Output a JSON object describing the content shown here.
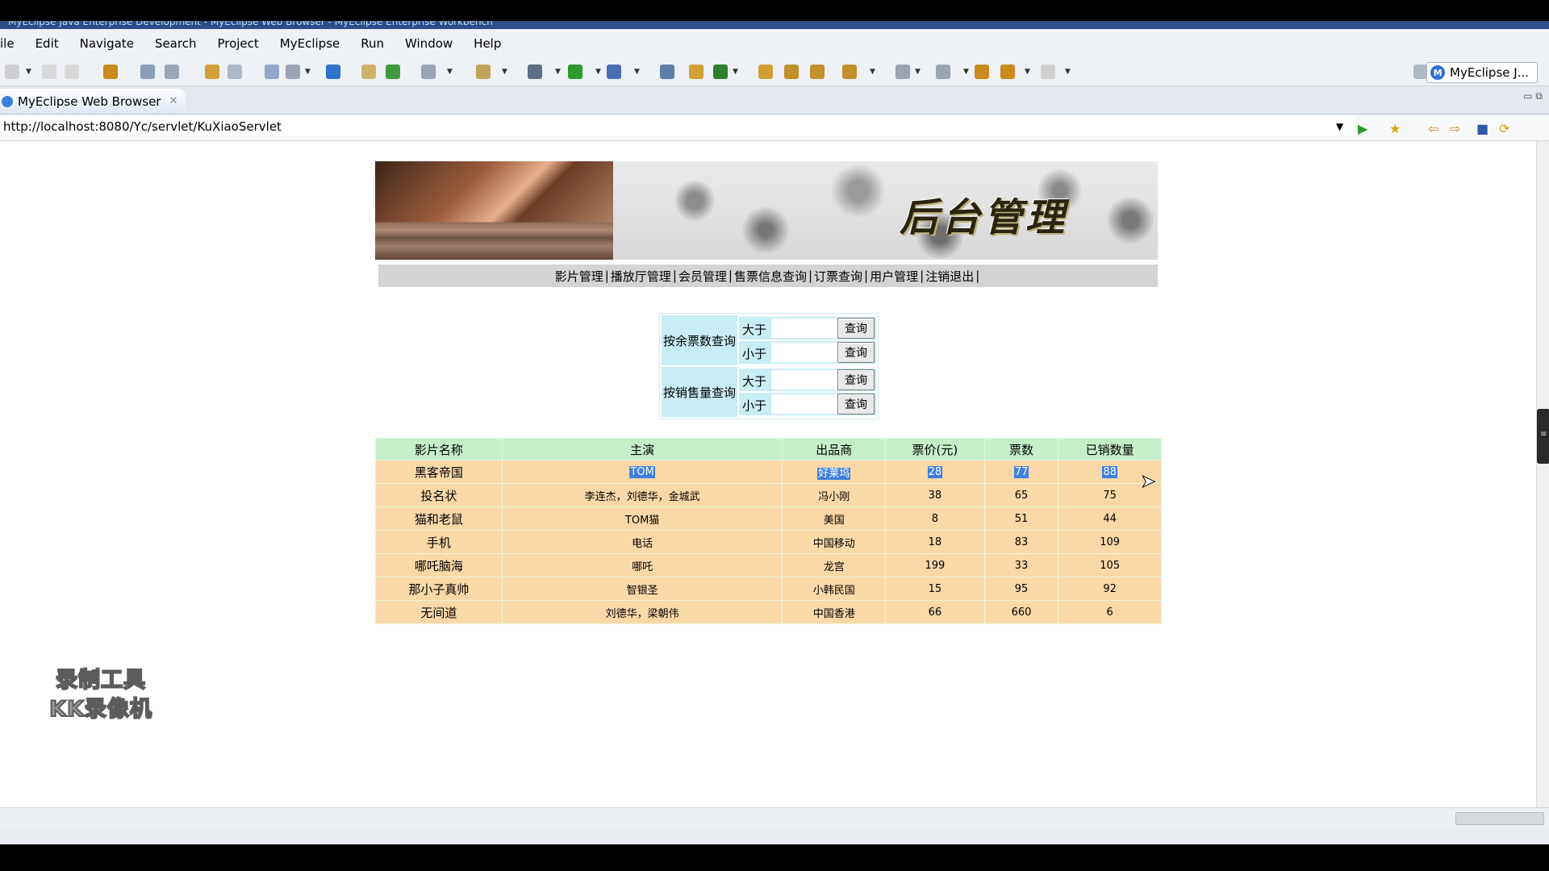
{
  "window": {
    "title": "MyEclipse Java Enterprise Development - MyEclipse Web Browser - MyEclipse Enterprise Workbench"
  },
  "menu": [
    "ile",
    "Edit",
    "Navigate",
    "Search",
    "Project",
    "MyEclipse",
    "Run",
    "Window",
    "Help"
  ],
  "perspective": {
    "label": "MyEclipse J...",
    "icon": "M"
  },
  "editor_tab": {
    "label": "MyEclipse Web Browser",
    "close": "✕"
  },
  "url": "http://localhost:8080/Yc/servlet/KuXiaoServlet",
  "page": {
    "banner_title": "后台管理",
    "nav": [
      "影片管理",
      "播放厅管理",
      "会员管理",
      "售票信息查询",
      "订票查询",
      "用户管理",
      "注销退出"
    ],
    "nav_separator": "|",
    "query": {
      "groups": [
        {
          "label": "按余票数查询",
          "rows": [
            {
              "label": "大于",
              "button": "查询"
            },
            {
              "label": "小于",
              "button": "查询"
            }
          ]
        },
        {
          "label": "按销售量查询",
          "rows": [
            {
              "label": "大于",
              "button": "查询"
            },
            {
              "label": "小于",
              "button": "查询"
            }
          ]
        }
      ]
    },
    "table": {
      "headers": [
        "影片名称",
        "主演",
        "出品商",
        "票价(元)",
        "票数",
        "已销数量"
      ],
      "rows": [
        [
          "黑客帝国",
          "TOM",
          "好莱坞",
          "28",
          "77",
          "88"
        ],
        [
          "投名状",
          "李连杰，刘德华，金城武",
          "冯小刚",
          "38",
          "65",
          "75"
        ],
        [
          "猫和老鼠",
          "TOM猫",
          "美国",
          "8",
          "51",
          "44"
        ],
        [
          "手机",
          "电话",
          "中国移动",
          "18",
          "83",
          "109"
        ],
        [
          "哪吒脑海",
          "哪吒",
          "龙宫",
          "199",
          "33",
          "105"
        ],
        [
          "那小子真帅",
          "智银圣",
          "小韩民国",
          "15",
          "95",
          "92"
        ],
        [
          "无间道",
          "刘德华，梁朝伟",
          "中国香港",
          "66",
          "660",
          "6"
        ]
      ]
    }
  },
  "watermark": {
    "line1": "录制工具",
    "line2": "KK录像机"
  },
  "colors": {
    "query_bg": "#c7eef4",
    "header_bg": "#c4f0c8",
    "row_bg": "#fbd8a8",
    "selection": "#3f7fe0"
  }
}
